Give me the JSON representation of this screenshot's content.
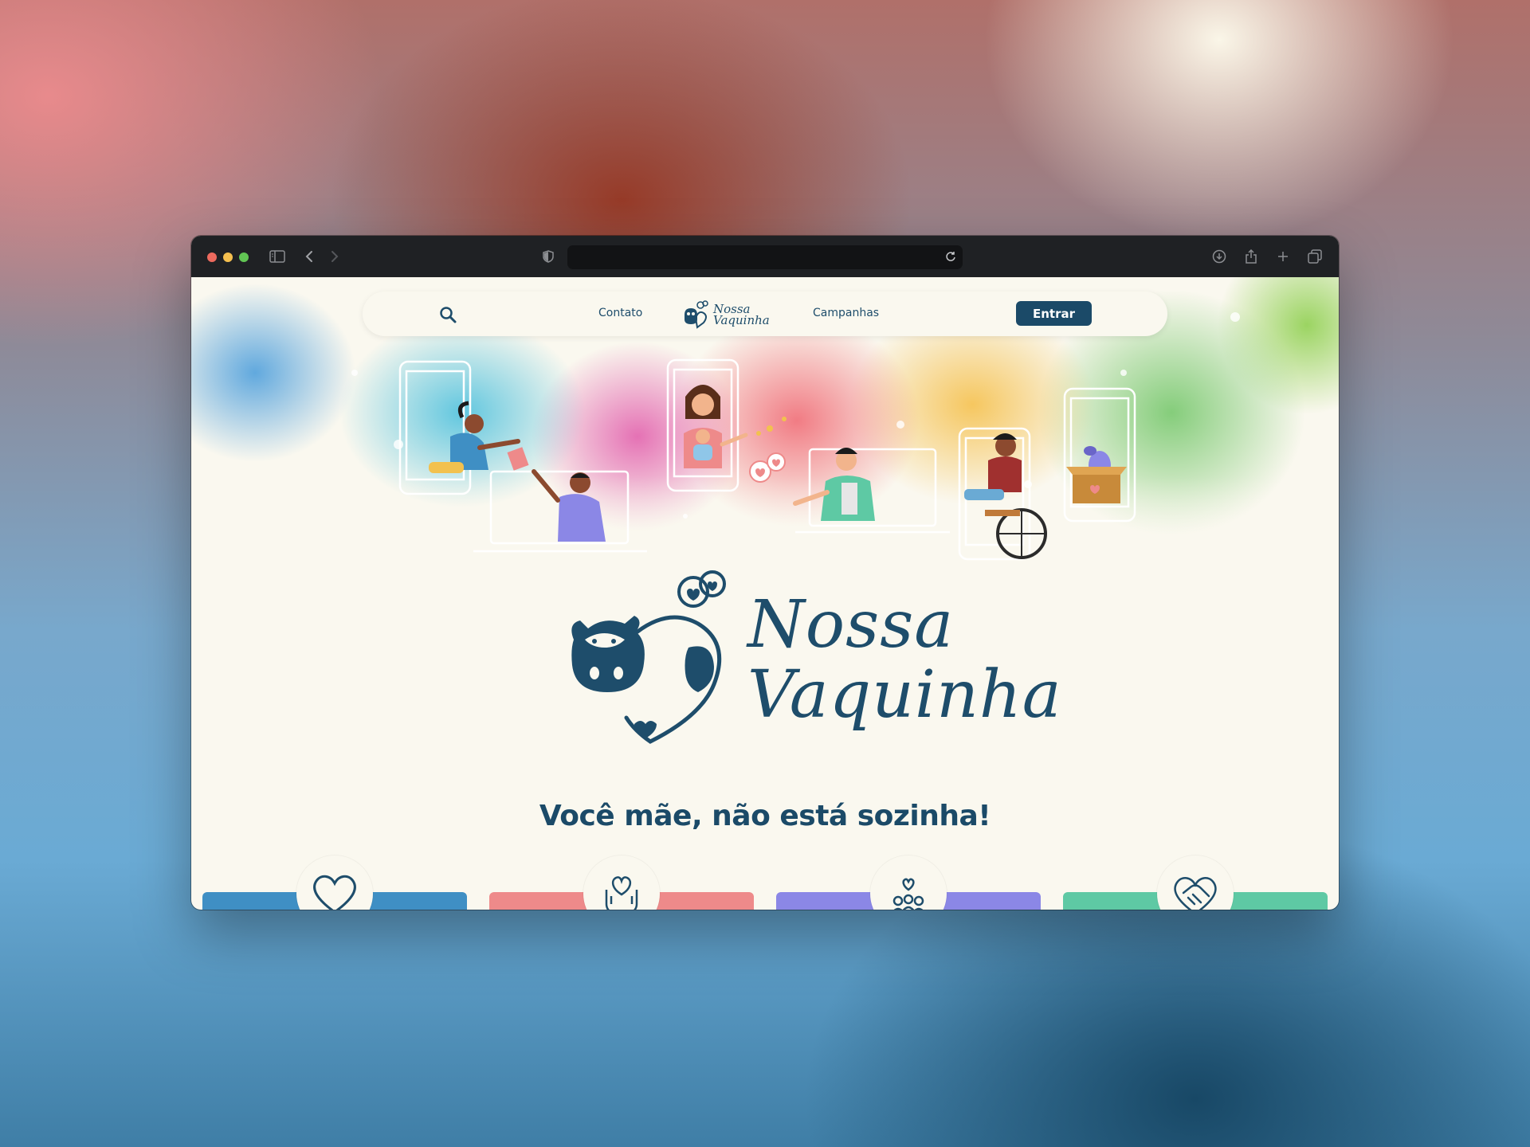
{
  "browser": {
    "url_value": "",
    "traffic_colors": [
      "#ed6a5e",
      "#f5bf4f",
      "#61c554"
    ],
    "icons": [
      "sidebar-icon",
      "back-icon",
      "forward-icon",
      "shield-icon",
      "reload-icon",
      "download-icon",
      "share-icon",
      "new-tab-icon",
      "tabs-overview-icon"
    ]
  },
  "nav": {
    "search_icon": "search-icon",
    "contato": "Contato",
    "campanhas": "Campanhas",
    "logo_line1": "Nossa",
    "logo_line2": "Vaquinha",
    "entrar": "Entrar"
  },
  "hero": {
    "logo_line1": "Nossa",
    "logo_line2": "Vaquinha",
    "tagline": "Você mãe, não está sozinha!"
  },
  "cards": [
    {
      "icon": "heart-icon",
      "color": "#3f8fc4"
    },
    {
      "icon": "hands-heart-icon",
      "color": "#ee8a8a"
    },
    {
      "icon": "community-icon",
      "color": "#8b87e6"
    },
    {
      "icon": "handshake-heart-icon",
      "color": "#5ec9a4"
    }
  ],
  "colors": {
    "brand": "#1b4a68",
    "background": "#faf8ef"
  }
}
